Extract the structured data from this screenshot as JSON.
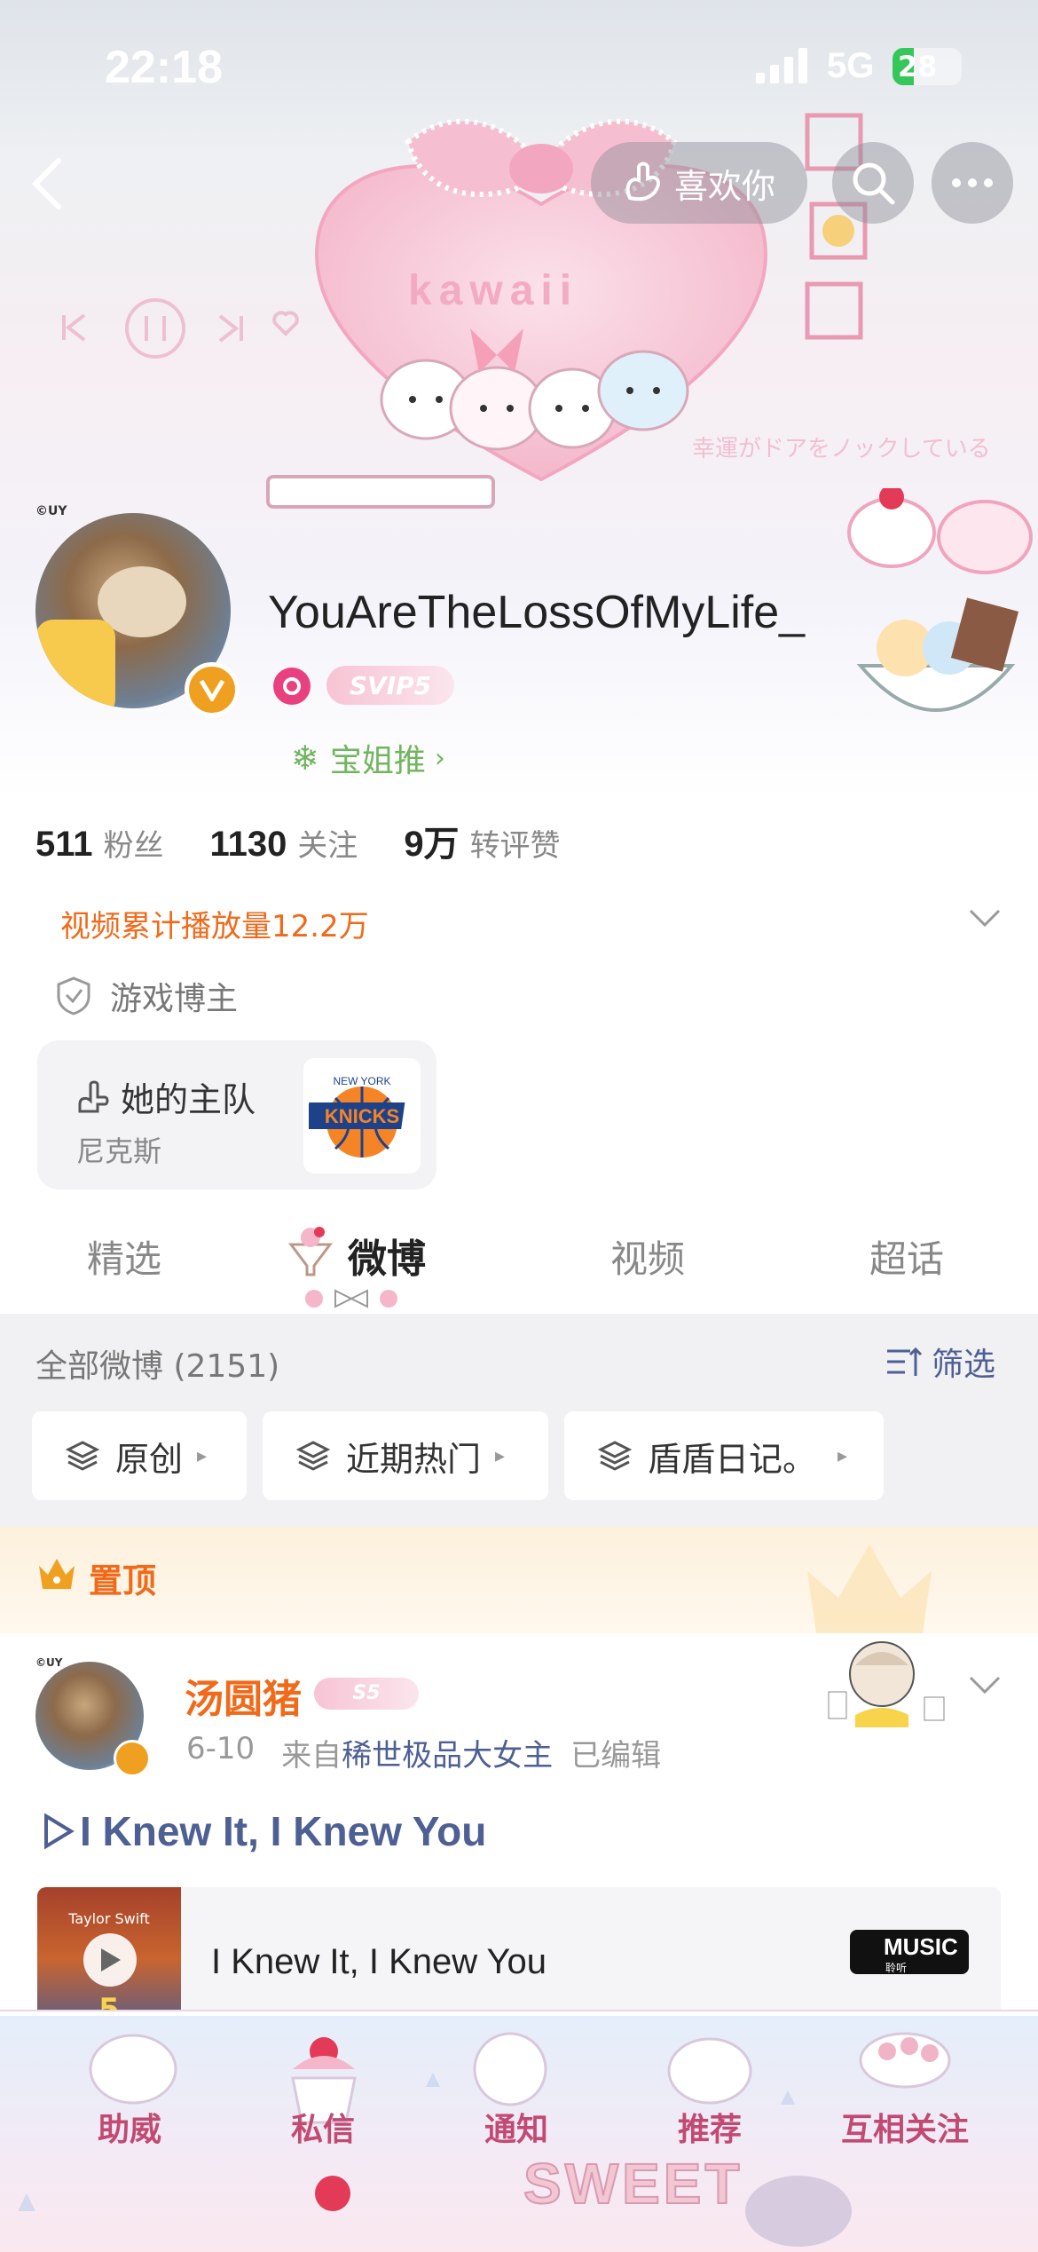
{
  "status_bar": {
    "time": "22:18",
    "network": "5G",
    "battery": "28"
  },
  "header": {
    "like_label": "喜欢你",
    "banner_text": "kawaii",
    "banner_jp": "幸運がドアをノックしている"
  },
  "profile": {
    "avatar_tag": "©UY",
    "username": "YouAreTheLossOfMyLife_",
    "vip_badge": "SVIP5",
    "recommend_label": "宝姐推",
    "stats": [
      {
        "value": "511",
        "label": "粉丝"
      },
      {
        "value": "1130",
        "label": "关注"
      },
      {
        "value": "9万",
        "label": "转评赞"
      }
    ],
    "video_plays": "视频累计播放量12.2万",
    "verified_tag": "游戏博主",
    "team_card": {
      "title": "她的主队",
      "team": "尼克斯",
      "logo_text": "KNICKS",
      "logo_sub": "NEW YORK"
    }
  },
  "tabs": [
    {
      "label": "精选",
      "active": false
    },
    {
      "label": "微博",
      "active": true
    },
    {
      "label": "视频",
      "active": false
    },
    {
      "label": "超话",
      "active": false
    }
  ],
  "feed": {
    "all_label": "全部微博 (2151)",
    "filter_label": "筛选",
    "chips": [
      "原创",
      "近期热门",
      "盾盾日记。"
    ]
  },
  "pinned": {
    "label": "置顶"
  },
  "post": {
    "avatar_tag": "©UY",
    "author": "汤圆猪",
    "author_badge": "S5",
    "date": "6-10",
    "from_prefix": "来自",
    "source": "稀世极品大女主",
    "edited": "已编辑",
    "link_title": "I Knew It, I Knew You",
    "music": {
      "title": "I Knew It, I Knew You",
      "cover_text": "Taylor Swift",
      "cover_num": "5",
      "service": "MUSIC",
      "service_sub": "聆听"
    }
  },
  "bottom_nav": {
    "items": [
      "助威",
      "私信",
      "通知",
      "推荐",
      "互相关注"
    ],
    "deco_text": "SWEET"
  },
  "colors": {
    "accent_orange": "#f06a1a",
    "link_blue": "#4e5f94",
    "pink": "#c24a72",
    "gold": "#f0a020"
  }
}
